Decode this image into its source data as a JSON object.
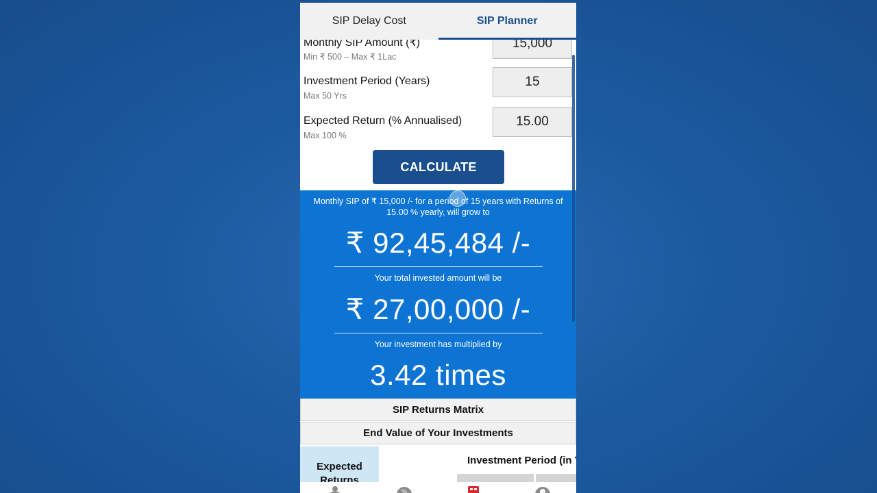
{
  "tabs": [
    {
      "label": "SIP Delay Cost",
      "active": false
    },
    {
      "label": "SIP Planner",
      "active": true
    }
  ],
  "form": {
    "monthly_sip": {
      "label": "Monthly SIP Amount (₹)",
      "hint": "Min ₹ 500 – Max ₹ 1Lac",
      "value": "15,000"
    },
    "period": {
      "label": "Investment Period (Years)",
      "hint": "Max 50 Yrs",
      "value": "15"
    },
    "expected_return": {
      "label": "Expected Return (% Annualised)",
      "hint": "Max 100 %",
      "value": "15.00"
    },
    "calculate_label": "CALCULATE"
  },
  "result": {
    "summary": "Monthly SIP of ₹ 15,000 /- for a period of 15 years with Returns of 15.00 % yearly, will grow to",
    "future_value": "₹ 92,45,484 /-",
    "invested_caption": "Your total invested amount will be",
    "invested_value": "₹ 27,00,000 /-",
    "multiplied_caption": "Your investment has multiplied by",
    "multiplier": "3.42 times"
  },
  "matrix": {
    "title": "SIP Returns Matrix",
    "subtitle": "End Value of Your Investments",
    "row_header": "Expected Returns",
    "col_header": "Investment Period (in Y"
  },
  "colors": {
    "primary": "#1a4f8e",
    "result_bg": "#0d74d4",
    "nav_accent": "#d9262c"
  }
}
